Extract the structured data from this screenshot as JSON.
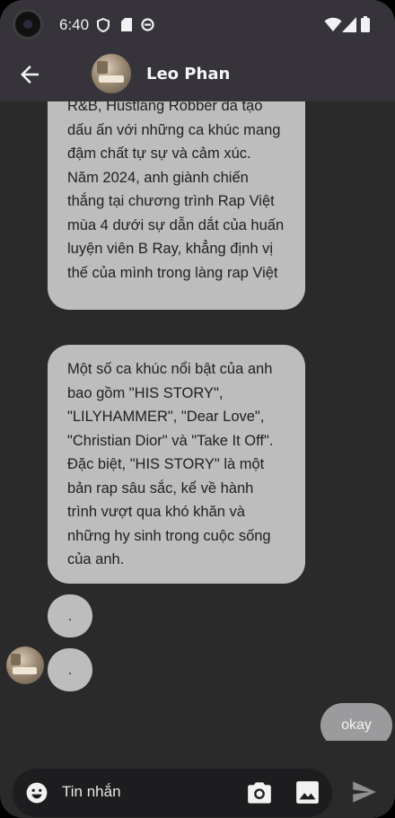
{
  "status_bar": {
    "time": "6:40"
  },
  "header": {
    "contact_name": "Leo Phan"
  },
  "messages": [
    {
      "sender": "contact",
      "text": "R&B, Hustlang Robber đã tạo dấu ấn với những ca khúc mang đậm chất tự sự và cảm xúc. Năm 2024, anh giành chiến thắng tại chương trình Rap Việt mùa 4 dưới sự dẫn dắt của huấn luyện viên B Ray, khẳng định vị thế của mình trong làng rap Việt"
    },
    {
      "sender": "contact",
      "text": "Một số ca khúc nổi bật của anh bao gồm \"HIS STORY\", \"LILYHAMMER\", \"Dear Love\", \"Christian Dior\" và \"Take It Off\". Đặc biệt, \"HIS STORY\" là một bản rap sâu sắc, kể về hành trình vượt qua khó khăn và những hy sinh trong cuộc sống của anh."
    },
    {
      "sender": "contact",
      "text": "."
    },
    {
      "sender": "contact",
      "text": "."
    },
    {
      "sender": "me",
      "text": "okay"
    }
  ],
  "composer": {
    "placeholder": "Tin nhắn"
  },
  "icons": {
    "back": "arrow-left-icon",
    "emoji": "emoji-icon",
    "camera": "camera-icon",
    "gallery": "image-icon",
    "send": "send-icon"
  },
  "colors": {
    "background": "#2b2a2b",
    "app_bar": "#36343a",
    "received_bubble": "#bebdbe",
    "sent_bubble": "#9b9a9c",
    "input_bar": "#1d1c1e"
  }
}
